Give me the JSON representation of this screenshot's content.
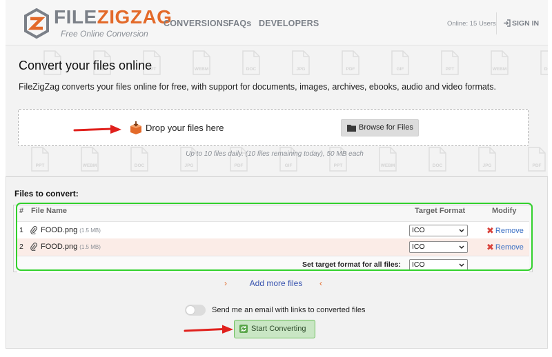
{
  "brand": {
    "name_part1": "FILE",
    "name_part2": "ZIGZAG",
    "tagline": "Free Online Conversion",
    "colors": {
      "orange": "#e36a2a",
      "gray": "#7b8088"
    }
  },
  "nav": {
    "items": [
      {
        "label": "CONVERSIONS"
      },
      {
        "label": "FAQs"
      },
      {
        "label": "DEVELOPERS"
      }
    ],
    "online_status": "Online: 15 Users",
    "signin_label": "SIGN IN",
    "signin_icon": "sign-in-icon"
  },
  "hero": {
    "title": "Convert your files online",
    "description": "FileZigZag converts your files online for free, with support for documents, images, archives, ebooks, audio and video formats.",
    "drop_text": "Drop your files here",
    "drop_icon": "download-box-icon",
    "browse_label": "Browse for Files",
    "browse_icon": "folder-icon",
    "limits_text": "Up to 10 files daily. (10 files remaining today), 50 MB each",
    "background_icon_labels": [
      "PDF",
      "GIF",
      "PPT",
      "WEBM",
      "DOC",
      "JPG"
    ]
  },
  "files": {
    "section_label": "Files to convert:",
    "columns": {
      "index": "#",
      "name": "File Name",
      "target_format": "Target Format",
      "modify": "Modify"
    },
    "rows": [
      {
        "index": "1",
        "name": "FOOD.png",
        "size": "(1.5 MB)",
        "format": "ICO",
        "remove_label": "Remove"
      },
      {
        "index": "2",
        "name": "FOOD.png",
        "size": "(1.5 MB)",
        "format": "ICO",
        "remove_label": "Remove"
      }
    ],
    "set_all_label": "Set target format for all files:",
    "set_all_value": "ICO",
    "add_more_label": "Add more files",
    "chevron_left": "›",
    "chevron_right": "‹"
  },
  "footer": {
    "email_toggle_label": "Send me an email with links to converted files",
    "email_toggle_on": false,
    "start_label": "Start Converting",
    "start_icon": "convert-cycle-icon"
  },
  "highlight": {
    "outline_color": "#32d12c",
    "arrow_color": "#e0201c"
  }
}
